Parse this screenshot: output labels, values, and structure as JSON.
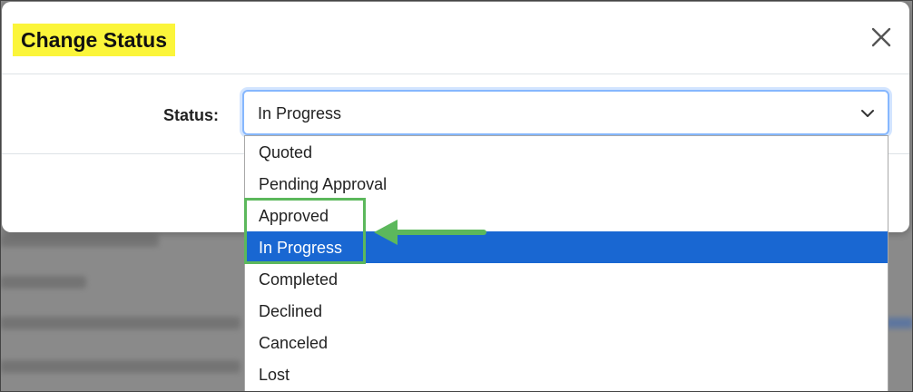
{
  "modal": {
    "title": "Change Status",
    "close_icon": "close-icon"
  },
  "form": {
    "status_label": "Status:",
    "selected_value": "In Progress",
    "chevron_icon": "chevron-down-icon"
  },
  "dropdown": {
    "options": [
      "Quoted",
      "Pending Approval",
      "Approved",
      "In Progress",
      "Completed",
      "Declined",
      "Canceled",
      "Lost"
    ],
    "selected_index": 3
  },
  "colors": {
    "title_highlight": "#fbf53a",
    "selected_option": "#1967d2",
    "annotation": "#5cb85c",
    "focus_border": "#86b7fe"
  }
}
